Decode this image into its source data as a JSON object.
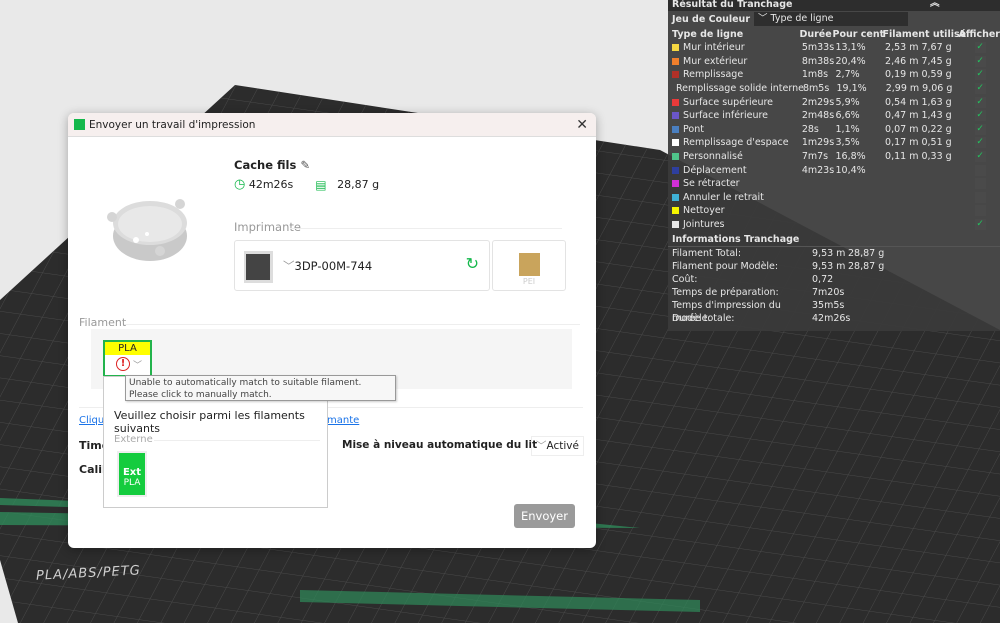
{
  "bed": {
    "label": "PLA/ABS/PETG"
  },
  "panel": {
    "title": "Résultat du Tranchage",
    "color_scheme_label": "Jeu de Couleur",
    "color_scheme_value": "Type de ligne",
    "headers": [
      "Type de ligne",
      "Durée",
      "Pour cent",
      "Filament utilisé",
      "Afficher"
    ],
    "rows": [
      {
        "name": "Mur intérieur",
        "color": "#f5d742",
        "time": "5m33s",
        "pct": "13,1%",
        "fil": "2,53 m 7,67 g",
        "show": true
      },
      {
        "name": "Mur extérieur",
        "color": "#f07f2c",
        "time": "8m38s",
        "pct": "20,4%",
        "fil": "2,46 m 7,45 g",
        "show": true
      },
      {
        "name": "Remplissage",
        "color": "#b03027",
        "time": "1m8s",
        "pct": "2,7%",
        "fil": "0,19 m 0,59 g",
        "show": true
      },
      {
        "name": "Remplissage solide interne",
        "color": "#9b4bc9",
        "time": "8m5s",
        "pct": "19,1%",
        "fil": "2,99 m 9,06 g",
        "show": true
      },
      {
        "name": "Surface supérieure",
        "color": "#e83a3a",
        "time": "2m29s",
        "pct": "5,9%",
        "fil": "0,54 m 1,63 g",
        "show": true
      },
      {
        "name": "Surface inférieure",
        "color": "#6a56c9",
        "time": "2m48s",
        "pct": "6,6%",
        "fil": "0,47 m 1,43 g",
        "show": true
      },
      {
        "name": "Pont",
        "color": "#4a7fc0",
        "time": "28s",
        "pct": "1,1%",
        "fil": "0,07 m 0,22 g",
        "show": true
      },
      {
        "name": "Remplissage d'espace",
        "color": "#ffffff",
        "time": "1m29s",
        "pct": "3,5%",
        "fil": "0,17 m 0,51 g",
        "show": true
      },
      {
        "name": "Personnalisé",
        "color": "#4fc48a",
        "time": "7m7s",
        "pct": "16,8%",
        "fil": "0,11 m 0,33 g",
        "show": true
      },
      {
        "name": "Déplacement",
        "color": "#2e3f9e",
        "time": "4m23s",
        "pct": "10,4%",
        "fil": "",
        "show": false
      },
      {
        "name": "Se rétracter",
        "color": "#d22fd6",
        "time": "",
        "pct": "",
        "fil": "",
        "show": false
      },
      {
        "name": "Annuler le retrait",
        "color": "#3fb1d6",
        "time": "",
        "pct": "",
        "fil": "",
        "show": false
      },
      {
        "name": "Nettoyer",
        "color": "#f5f500",
        "time": "",
        "pct": "",
        "fil": "",
        "show": false
      },
      {
        "name": "Jointures",
        "color": "#e6e6e6",
        "time": "",
        "pct": "",
        "fil": "",
        "show": true
      }
    ],
    "info_title": "Informations Tranchage",
    "info": [
      {
        "k": "Filament Total:",
        "v": "9,53 m",
        "w": "28,87 g"
      },
      {
        "k": "Filament pour Modèle:",
        "v": "9,53 m",
        "w": "28,87 g"
      },
      {
        "k": "Coût:",
        "v": "0,72",
        "w": ""
      },
      {
        "k": "Temps de préparation:",
        "v": "7m20s",
        "w": ""
      },
      {
        "k": "Temps d'impression du modèle:",
        "v": "35m5s",
        "w": ""
      },
      {
        "k": "Durée totale:",
        "v": "42m26s",
        "w": ""
      }
    ]
  },
  "dialog": {
    "title": "Envoyer un travail d'impression",
    "model_name": "Cache fils",
    "time": "42m26s",
    "weight": "28,87 g",
    "printer_section": "Imprimante",
    "printer_name": "3DP-00M-744",
    "plate": "PEI",
    "filament_section": "Filament",
    "filament_type": "PLA",
    "tooltip": "Unable to automatically match to suitable filament. Please click to manually match.",
    "popup_title": "Veuillez choisir parmi les filaments suivants",
    "popup_group": "Externe",
    "popup_item_top": "Ext",
    "popup_item_bottom": "PLA",
    "link_start": "Clique",
    "link_end": "mante",
    "opt1_label": "Time",
    "opt2_label": "Calib",
    "bed_level_label": "Mise à niveau automatique du lit",
    "bed_level_value": "Activé",
    "send": "Envoyer"
  }
}
